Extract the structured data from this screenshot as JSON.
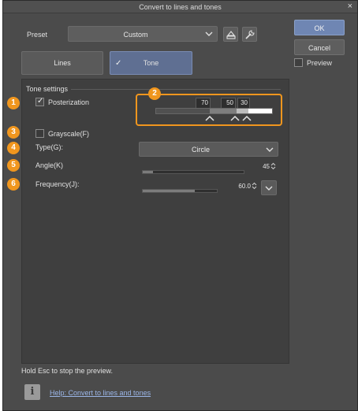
{
  "window": {
    "title": "Convert to lines and tones",
    "close_glyph": "×"
  },
  "preset": {
    "label": "Preset",
    "value": "Custom"
  },
  "buttons": {
    "ok": "OK",
    "cancel": "Cancel",
    "preview_label": "Preview",
    "preview_checked": false
  },
  "tabs": [
    {
      "label": "Lines",
      "active": false
    },
    {
      "label": "Tone",
      "active": true,
      "checked_glyph": "✓"
    }
  ],
  "tone_settings": {
    "group_title": "Tone settings",
    "posterization": {
      "label": "Posterization",
      "checked": true,
      "check_glyph": "✓"
    },
    "posterization_levels": [
      "70",
      "50",
      "30"
    ],
    "grayscale": {
      "label": "Grayscale(F)",
      "checked": false
    },
    "type": {
      "label": "Type(G):",
      "value": "Circle"
    },
    "angle": {
      "label": "Angle(K)",
      "value": "45",
      "level": 0.1
    },
    "frequency": {
      "label": "Frequency(J):",
      "value": "60.0",
      "level": 0.7
    }
  },
  "badges": [
    "1",
    "2",
    "3",
    "4",
    "5",
    "6"
  ],
  "footer": {
    "hint": "Hold Esc to stop the preview.",
    "info_glyph": "i",
    "help_link": "Help: Convert to lines and tones"
  },
  "colors": {
    "accent_badge": "#f0961e",
    "ok_button": "#6f86b3",
    "active_tab": "#5f6f92",
    "link": "#9bb6e8"
  }
}
